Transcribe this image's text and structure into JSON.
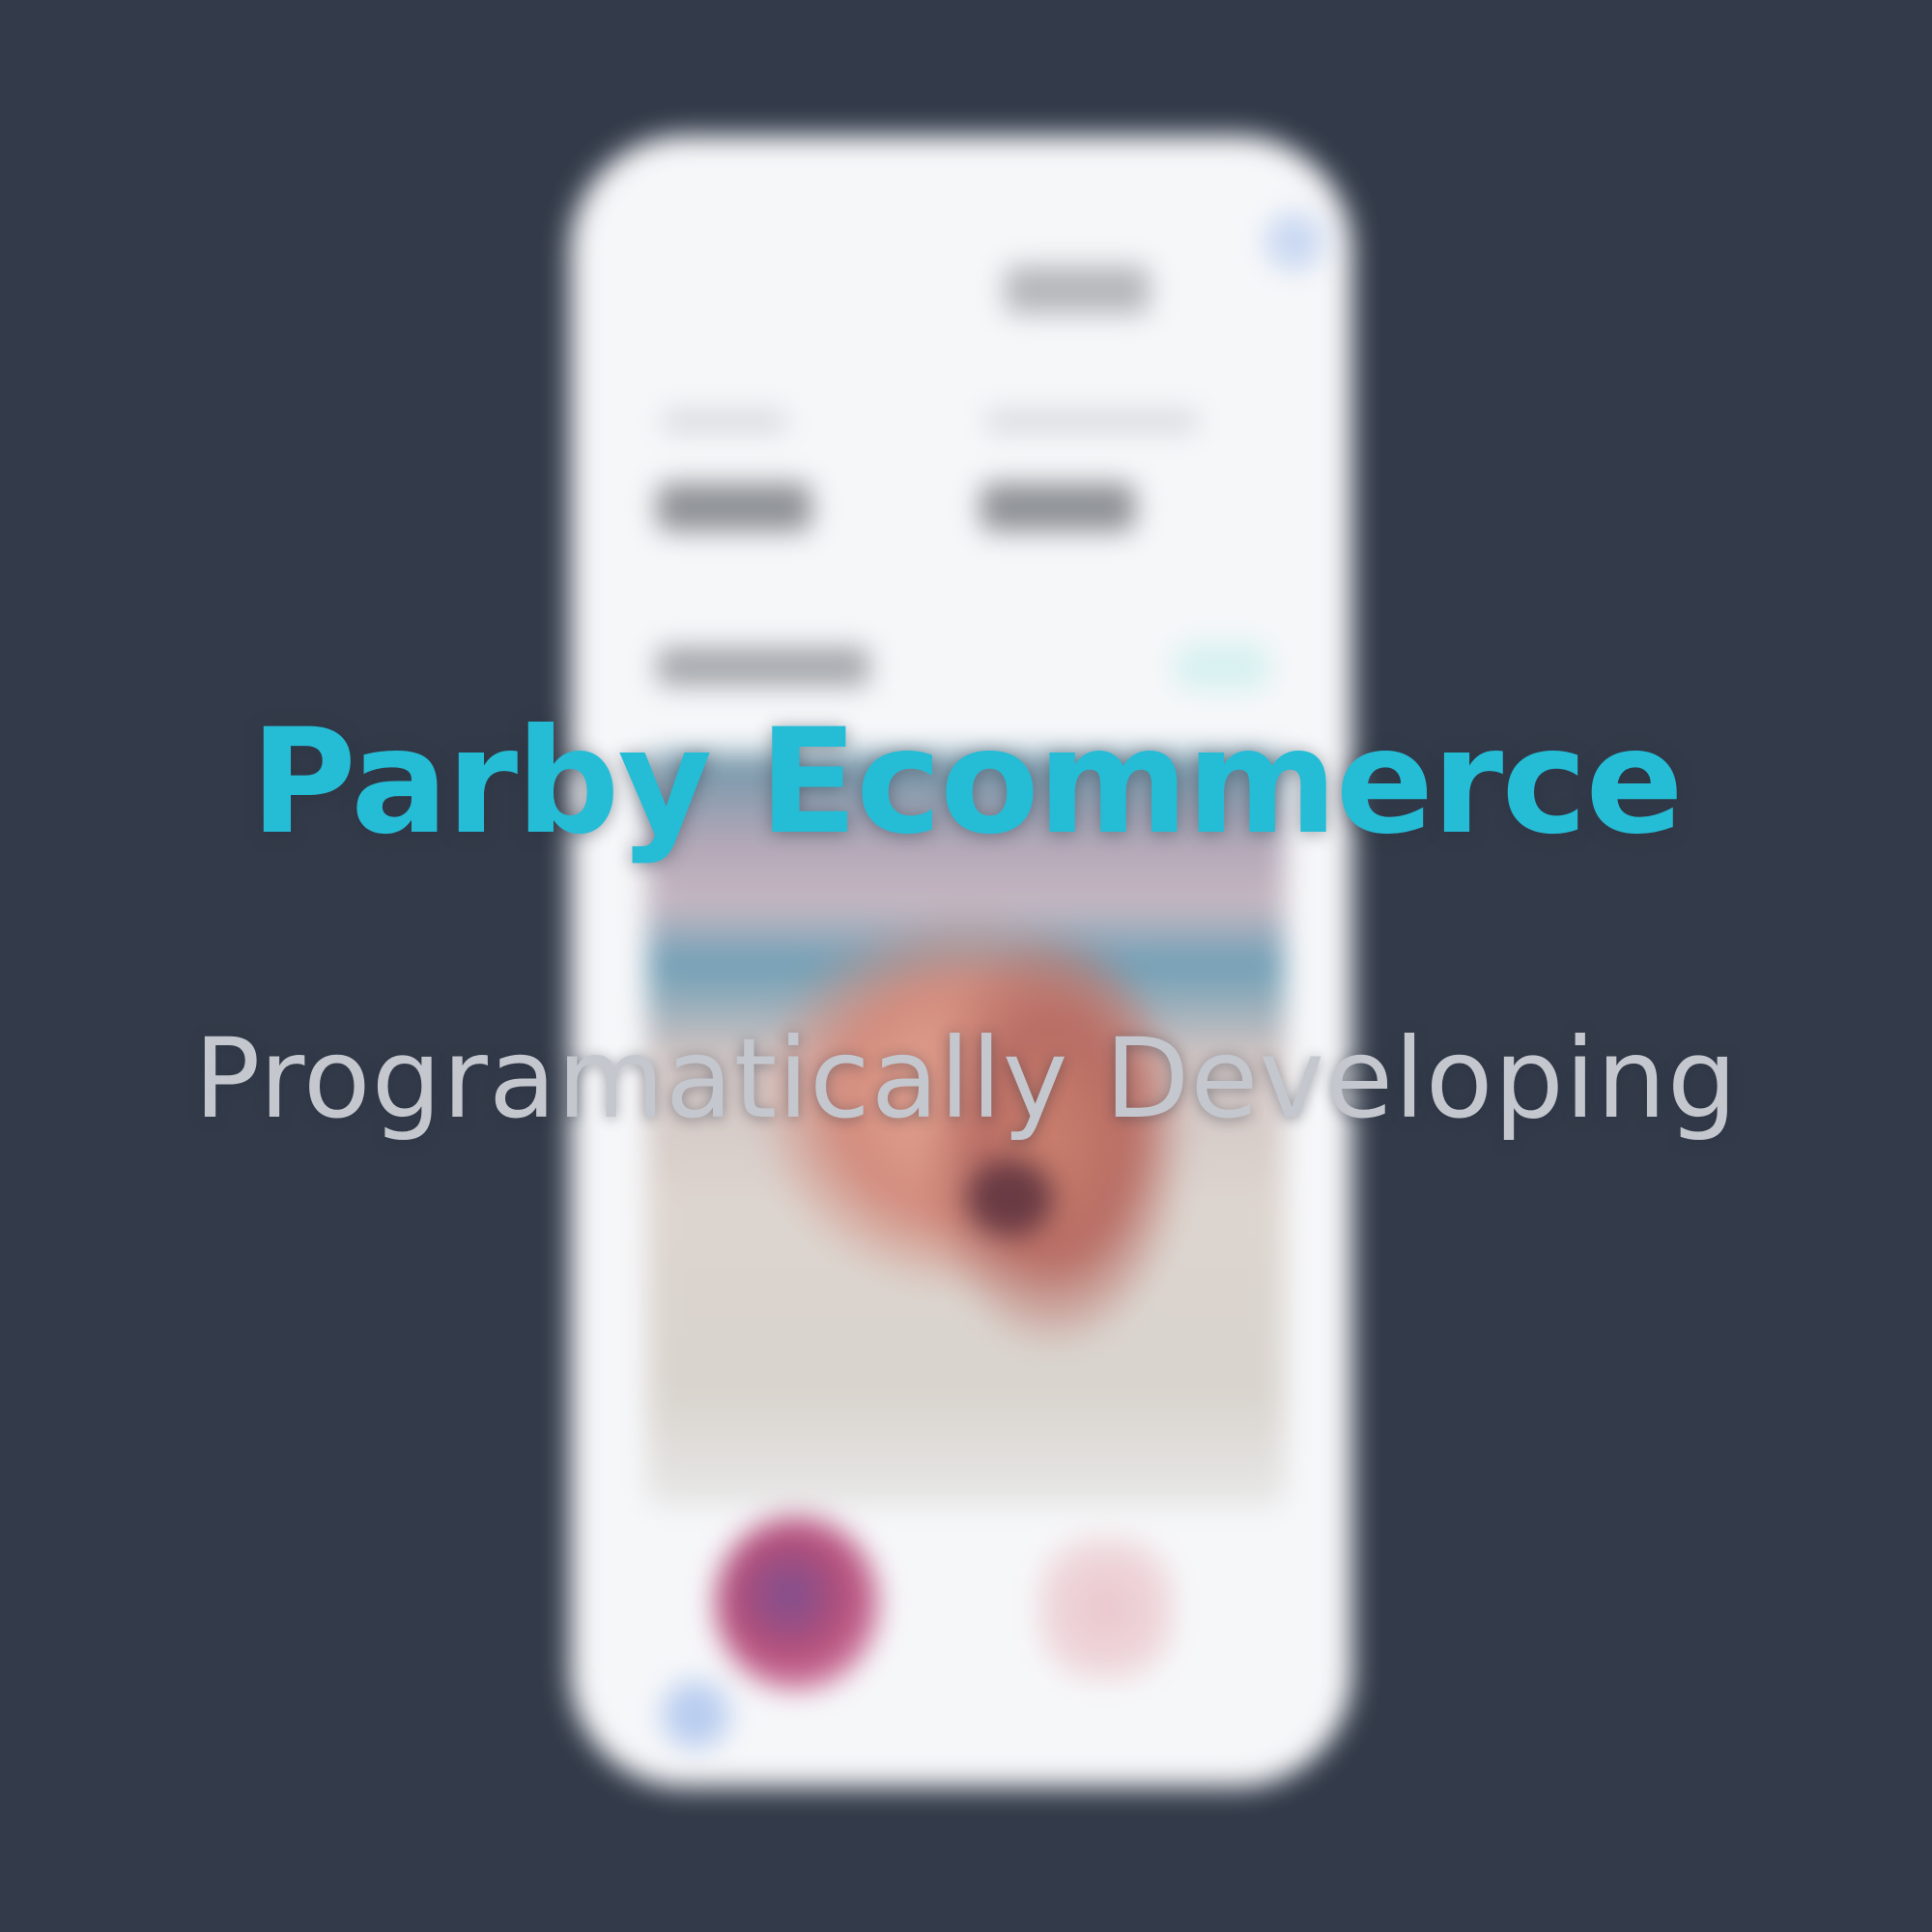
{
  "hero": {
    "title": "Parby Ecommerce",
    "subtitle": "Programatically Developing"
  },
  "colors": {
    "background": "#333b4a",
    "title": "#25bcd6",
    "subtitle": "#c4c7cd",
    "phone_screen": "#f6f7f9"
  }
}
